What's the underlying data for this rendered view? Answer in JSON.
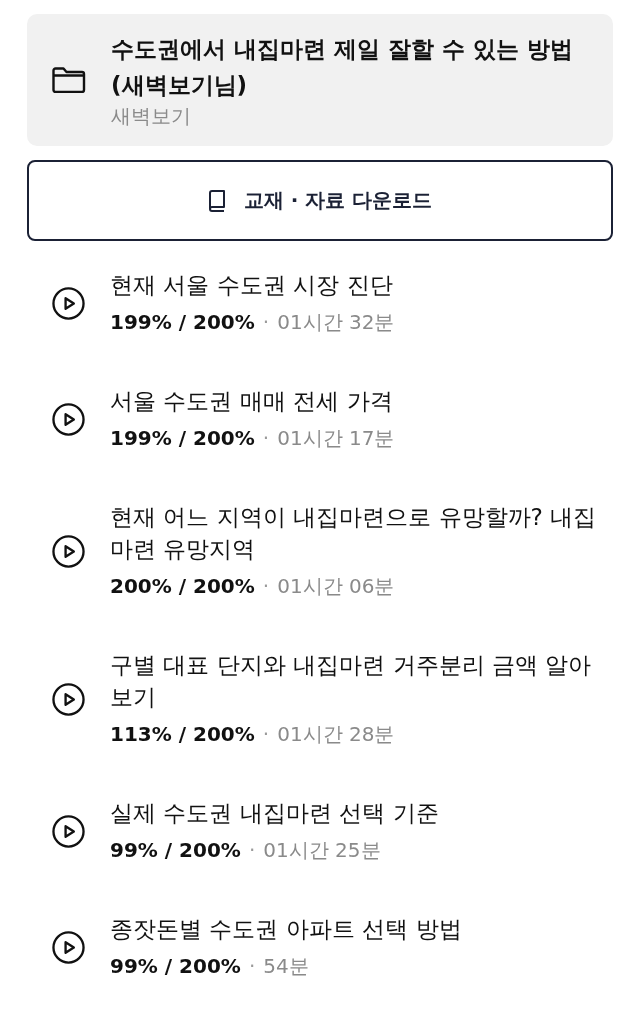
{
  "course": {
    "title": "수도권에서 내집마련 제일 잘할 수 있는 방법 (새벽보기님)",
    "instructor": "새벽보기"
  },
  "download_button": {
    "label": "교재 · 자료 다운로드"
  },
  "lectures": [
    {
      "title": "현재 서울 수도권 시장 진단",
      "progress": "199% / 200%",
      "separator": "·",
      "duration": "01시간 32분"
    },
    {
      "title": "서울 수도권 매매 전세 가격",
      "progress": "199% / 200%",
      "separator": "·",
      "duration": "01시간 17분"
    },
    {
      "title": "현재 어느 지역이 내집마련으로 유망할까? 내집마련 유망지역",
      "progress": "200% / 200%",
      "separator": "·",
      "duration": "01시간 06분"
    },
    {
      "title": "구별 대표 단지와 내집마련 거주분리 금액 알아보기",
      "progress": "113% / 200%",
      "separator": "·",
      "duration": "01시간 28분"
    },
    {
      "title": "실제 수도권 내집마련 선택 기준",
      "progress": "99% / 200%",
      "separator": "·",
      "duration": "01시간 25분"
    },
    {
      "title": "종잣돈별 수도권 아파트 선택 방법",
      "progress": "99% / 200%",
      "separator": "·",
      "duration": "54분"
    }
  ]
}
